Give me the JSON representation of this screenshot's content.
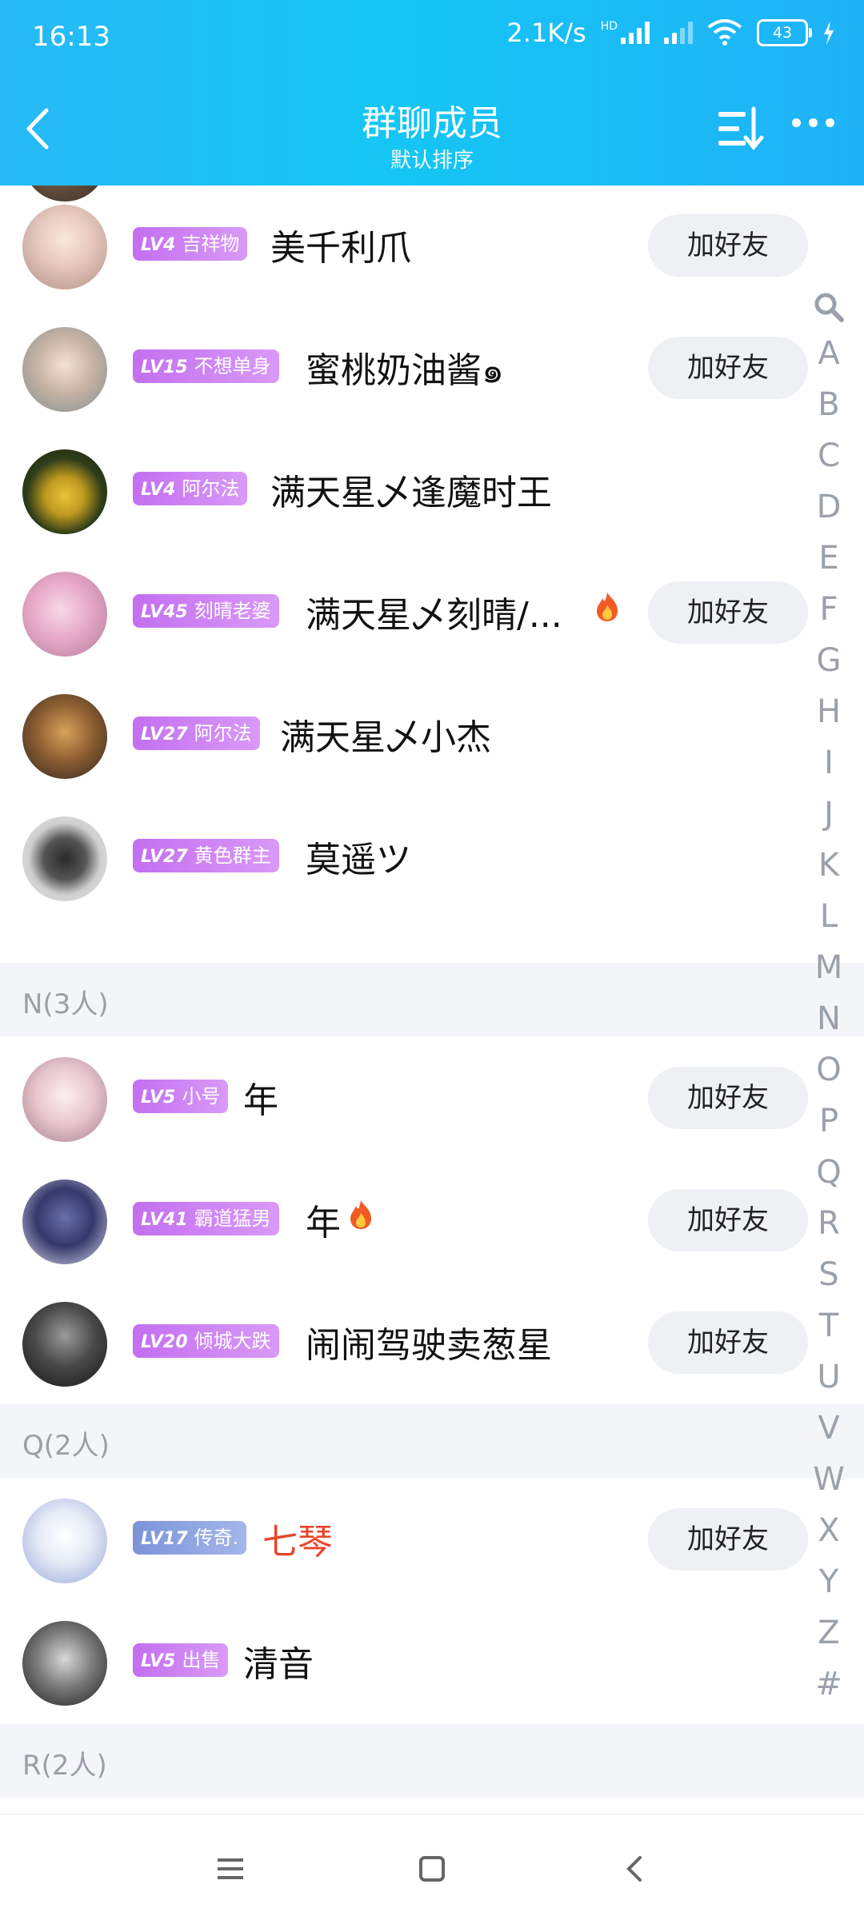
{
  "status_bar": {
    "time": "16:13",
    "speed": "2.1K/s",
    "network": "HD",
    "battery": "43"
  },
  "header": {
    "title": "群聊成员",
    "subtitle": "默认排序"
  },
  "colors": {
    "header_gradient": [
      "#27b9f6",
      "#1fb2f7"
    ],
    "tag_purple": "#c36ff0",
    "tag_blue": "#7c93d9",
    "vip_name": "#e8452a"
  },
  "add_friend_label": "加好友",
  "members_m": [
    {
      "level": "LV4",
      "title": "吉祥物",
      "name": "美千利爪",
      "add": true
    },
    {
      "level": "LV15",
      "title": "不想单身",
      "name": "蜜桃奶油酱๑",
      "add": true
    },
    {
      "level": "LV4",
      "title": "阿尔法",
      "name": "满天星乄逢魔时王",
      "add": false
    },
    {
      "level": "LV45",
      "title": "刻晴老婆",
      "name": "满天星乄刻晴/...",
      "add": true,
      "icon": "fire-icon"
    },
    {
      "level": "LV27",
      "title": "阿尔法",
      "name": "满天星乄小杰",
      "add": false
    },
    {
      "level": "LV27",
      "title": "黄色群主",
      "name": "莫遥ツ",
      "add": false
    }
  ],
  "section_n": {
    "label": "N(3人)"
  },
  "members_n": [
    {
      "level": "LV5",
      "title": "小号",
      "name": "年",
      "add": true
    },
    {
      "level": "LV41",
      "title": "霸道猛男",
      "name": "年",
      "add": true,
      "icon": "fire-icon"
    },
    {
      "level": "LV20",
      "title": "倾城大跌",
      "name": "闹闹驾驶卖葱星",
      "add": true
    }
  ],
  "section_q": {
    "label": "Q(2人)"
  },
  "members_q": [
    {
      "level": "LV17",
      "title": "传奇.",
      "name": "七琴",
      "add": true
    },
    {
      "level": "LV5",
      "title": "出售",
      "name": "清音",
      "add": false
    }
  ],
  "section_r": {
    "label": "R(2人)"
  },
  "index_letters": [
    "A",
    "B",
    "C",
    "D",
    "E",
    "F",
    "G",
    "H",
    "I",
    "J",
    "K",
    "L",
    "M",
    "N",
    "O",
    "P",
    "Q",
    "R",
    "S",
    "T",
    "U",
    "V",
    "W",
    "X",
    "Y",
    "Z",
    "#"
  ]
}
